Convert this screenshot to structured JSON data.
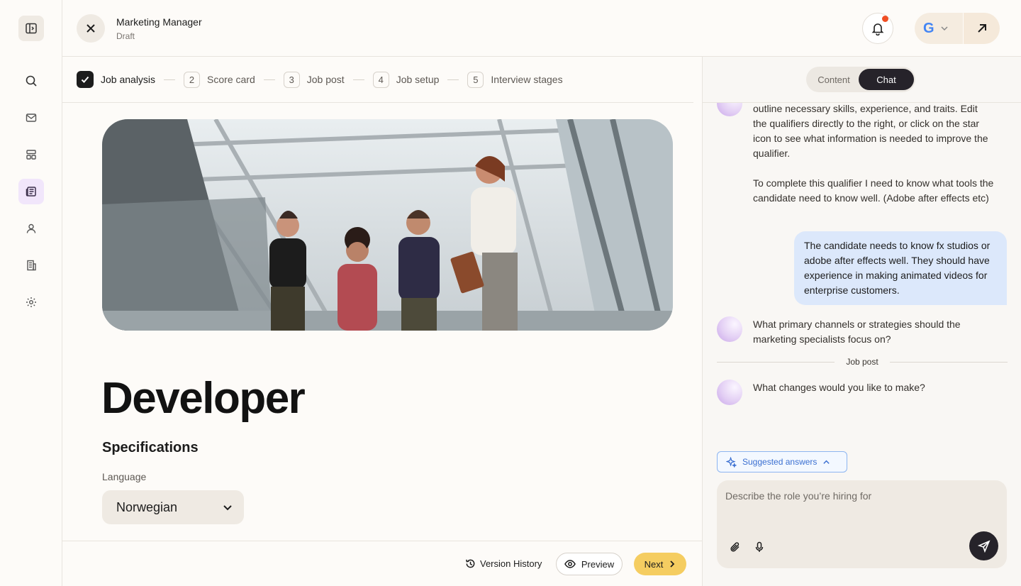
{
  "header": {
    "title": "Marketing Manager",
    "status": "Draft"
  },
  "stepper": {
    "steps": [
      {
        "number": "1",
        "label": "Job analysis",
        "done": true
      },
      {
        "number": "2",
        "label": "Score card"
      },
      {
        "number": "3",
        "label": "Job post"
      },
      {
        "number": "4",
        "label": "Job setup"
      },
      {
        "number": "5",
        "label": "Interview stages"
      }
    ]
  },
  "main": {
    "job_title": "Developer",
    "spec_title": "Specifications",
    "language_label": "Language",
    "language_value": "Norwegian"
  },
  "footer": {
    "version_history": "Version History",
    "preview": "Preview",
    "next": "Next"
  },
  "chat": {
    "tabs": [
      "Content",
      "Chat"
    ],
    "active_tab": "Chat",
    "messages": [
      {
        "from": "assistant",
        "text": "outline necessary skills, experience, and traits. Edit the qualifiers directly to the right, or click on the star icon to see what information is needed to improve the qualifier."
      },
      {
        "from": "assistant",
        "text": "To complete this qualifier I need to know what tools the candidate need to know well. (Adobe after effects etc)"
      },
      {
        "from": "user",
        "text": "The candidate needs to know fx studios or adobe after effects well. They should have experience in making animated videos for enterprise customers."
      },
      {
        "from": "assistant",
        "text": "What primary channels or strategies should the marketing specialists focus on?"
      },
      {
        "from": "assistant",
        "text": "What changes would you like to make?"
      }
    ],
    "section_divider": "Job post",
    "suggested_label": "Suggested answers",
    "input_placeholder": "Describe the role you’re hiring for"
  },
  "colors": {
    "accent_next": "#f5cd61",
    "user_bubble": "#dce8fb",
    "notification_dot": "#f04e23",
    "active_nav": "#f1e6fb"
  }
}
